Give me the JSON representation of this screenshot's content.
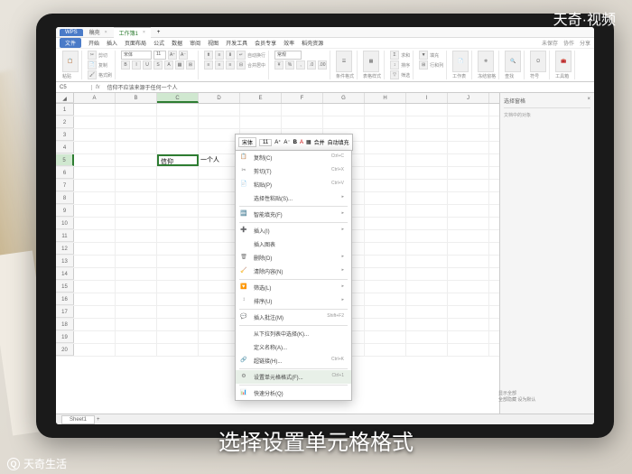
{
  "brand": {
    "top": "天奇·视频",
    "bottom": "天奇生活",
    "q": "Q"
  },
  "caption": "选择设置单元格格式",
  "tabs": {
    "wps": "WPS",
    "doc1": "稿壳",
    "doc2": "工作簿1"
  },
  "menu": {
    "file": "文件",
    "items": [
      "开始",
      "插入",
      "页面布局",
      "公式",
      "数据",
      "审阅",
      "视图",
      "开发工具",
      "会员专享",
      "效率",
      "稻壳资源"
    ],
    "right": [
      "未保存",
      "协作",
      "分享"
    ]
  },
  "toolbar": {
    "paste": "粘贴",
    "cut": "剪切",
    "copy": "复制",
    "format": "格式刷",
    "font": "宋体",
    "size": "11",
    "wrap": "自动换行",
    "merge": "合并居中",
    "general": "常规",
    "cond": "条件格式",
    "table": "表格样式",
    "sum": "求和",
    "sort": "排序",
    "filter": "筛选",
    "fill": "填充",
    "row": "行和列",
    "sheet": "工作表",
    "freeze": "冻结窗格",
    "find": "查找",
    "symbol": "符号",
    "tools": "工具箱"
  },
  "formula": {
    "cell": "C5",
    "fx": "fx",
    "text": "信仰不应该来源于任何一个人"
  },
  "cols": [
    "A",
    "B",
    "C",
    "D",
    "E",
    "F",
    "G",
    "H",
    "I",
    "J"
  ],
  "rows": [
    1,
    2,
    3,
    4,
    5,
    6,
    7,
    8,
    9,
    10,
    11,
    12,
    13,
    14,
    15,
    16,
    17,
    18,
    19,
    20
  ],
  "celltext": {
    "before": "信仰",
    "after": "一个人"
  },
  "sidebar": {
    "title": "选择窗格",
    "sub": "文档中的对象",
    "foot1": "显示全部",
    "foot2": "全部隐藏  设为默认"
  },
  "minitoolbar": {
    "font": "宋体",
    "size": "11",
    "bold": "B",
    "italic": "A",
    "fill": "A",
    "merge": "合并",
    "format": "自动填充"
  },
  "context": [
    {
      "icon": "📋",
      "label": "复制(C)",
      "key": "Ctrl+C"
    },
    {
      "icon": "✂",
      "label": "剪切(T)",
      "key": "Ctrl+X"
    },
    {
      "icon": "📄",
      "label": "粘贴(P)",
      "key": "Ctrl+V"
    },
    {
      "icon": "",
      "label": "选择性粘贴(S)...",
      "key": "",
      "arrow": "▸"
    },
    {
      "sep": true
    },
    {
      "icon": "🔤",
      "label": "智能填充(F)",
      "key": "",
      "arrow": "▸"
    },
    {
      "sep": true
    },
    {
      "icon": "➕",
      "label": "插入(I)",
      "key": "",
      "arrow": "▸"
    },
    {
      "icon": "",
      "label": "插入图表",
      "key": ""
    },
    {
      "icon": "🗑",
      "label": "删除(D)",
      "key": "",
      "arrow": "▸"
    },
    {
      "icon": "🧹",
      "label": "清除内容(N)",
      "key": "",
      "arrow": "▸"
    },
    {
      "sep": true
    },
    {
      "icon": "🔽",
      "label": "筛选(L)",
      "key": "",
      "arrow": "▸"
    },
    {
      "icon": "↕",
      "label": "排序(U)",
      "key": "",
      "arrow": "▸"
    },
    {
      "sep": true
    },
    {
      "icon": "💬",
      "label": "插入批注(M)",
      "key": "Shift+F2"
    },
    {
      "sep": true
    },
    {
      "icon": "",
      "label": "从下拉列表中选择(K)...",
      "key": ""
    },
    {
      "icon": "",
      "label": "定义名称(A)...",
      "key": ""
    },
    {
      "icon": "🔗",
      "label": "超链接(H)...",
      "key": "Ctrl+K"
    },
    {
      "sep": true
    },
    {
      "icon": "⚙",
      "label": "设置单元格格式(F)...",
      "key": "Ctrl+1",
      "hover": true
    },
    {
      "sep": true
    },
    {
      "icon": "📊",
      "label": "快速分析(Q)",
      "key": ""
    }
  ],
  "status": {
    "sheet": "Sheet1",
    "plus": "+"
  }
}
